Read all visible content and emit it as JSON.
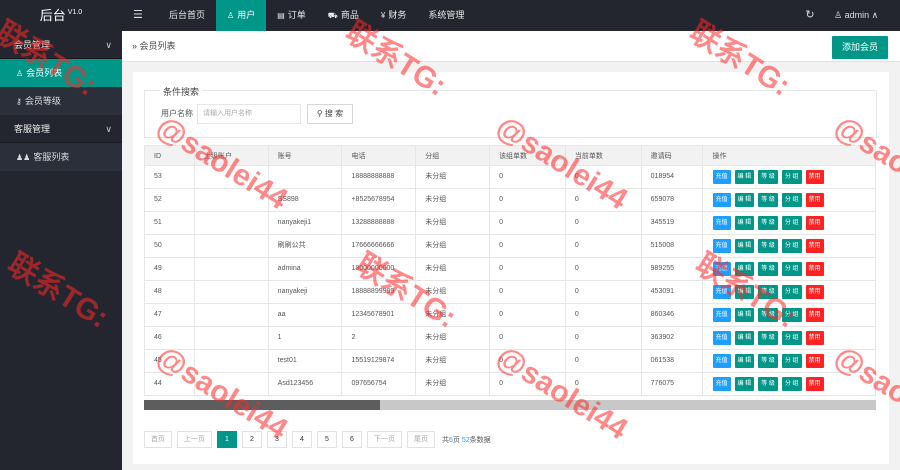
{
  "app": {
    "title": "后台",
    "version": "V1.0"
  },
  "topnav": {
    "items": [
      {
        "label": "后台首页",
        "icon": ""
      },
      {
        "label": "用户",
        "icon": "user-icon"
      },
      {
        "label": "订单",
        "icon": "document-icon"
      },
      {
        "label": "商品",
        "icon": "cart-icon"
      },
      {
        "label": "财务",
        "icon": "yen-icon"
      },
      {
        "label": "系统管理",
        "icon": ""
      }
    ],
    "active_index": 1,
    "admin_label": "admin"
  },
  "sidebar": {
    "groups": [
      {
        "label": "会员管理",
        "items": [
          {
            "label": "会员列表",
            "icon": "user-icon",
            "active": true
          },
          {
            "label": "会员等级",
            "icon": "key-icon",
            "active": false
          }
        ]
      },
      {
        "label": "客服管理",
        "items": [
          {
            "label": "客服列表",
            "icon": "users-icon",
            "active": false
          }
        ]
      }
    ]
  },
  "breadcrumb": {
    "label": "会员列表"
  },
  "add_button": "添加会员",
  "search": {
    "legend": "条件搜索",
    "label": "用户名称",
    "placeholder": "请输入用户名称",
    "button": "搜 索"
  },
  "table": {
    "headers": [
      "ID",
      "上级账户",
      "账号",
      "电话",
      "分组",
      "该组单数",
      "当前单数",
      "邀请码",
      "操作"
    ],
    "actions": [
      "充值",
      "编 辑",
      "等 级",
      "分 组",
      "禁用"
    ],
    "rows": [
      [
        "53",
        "",
        "",
        "18888888888",
        "未分组",
        "0",
        "0",
        "018954"
      ],
      [
        "52",
        "",
        "SS898",
        "+8525678954",
        "未分组",
        "0",
        "0",
        "659078"
      ],
      [
        "51",
        "",
        "nanyakeji1",
        "13288888888",
        "未分组",
        "0",
        "0",
        "345519"
      ],
      [
        "50",
        "",
        "刷刷公共",
        "17666666666",
        "未分组",
        "0",
        "0",
        "515008"
      ],
      [
        "49",
        "",
        "admina",
        "13000000000",
        "未分组",
        "0",
        "0",
        "989255"
      ],
      [
        "48",
        "",
        "nanyakeji",
        "18888899999",
        "未分组",
        "0",
        "0",
        "453091"
      ],
      [
        "47",
        "",
        "aa",
        "12345678901",
        "未分组",
        "0",
        "0",
        "860346"
      ],
      [
        "46",
        "",
        "1",
        "2",
        "未分组",
        "0",
        "0",
        "363902"
      ],
      [
        "45",
        "",
        "test01",
        "15519129874",
        "未分组",
        "0",
        "0",
        "061538"
      ],
      [
        "44",
        "",
        "Asd123456",
        "097656754",
        "未分组",
        "0",
        "0",
        "776075"
      ]
    ]
  },
  "pager": {
    "first": "首页",
    "prev": "上一页",
    "pages": [
      "1",
      "2",
      "3",
      "4",
      "5",
      "6"
    ],
    "current": "1",
    "next": "下一页",
    "last": "尾页",
    "info_prefix": "共",
    "total_pages": "6",
    "info_mid": "页 ",
    "total_items": "52",
    "info_suffix": "条数据"
  },
  "watermark": {
    "line1": "联系TG:",
    "line2": "@saolei44"
  }
}
